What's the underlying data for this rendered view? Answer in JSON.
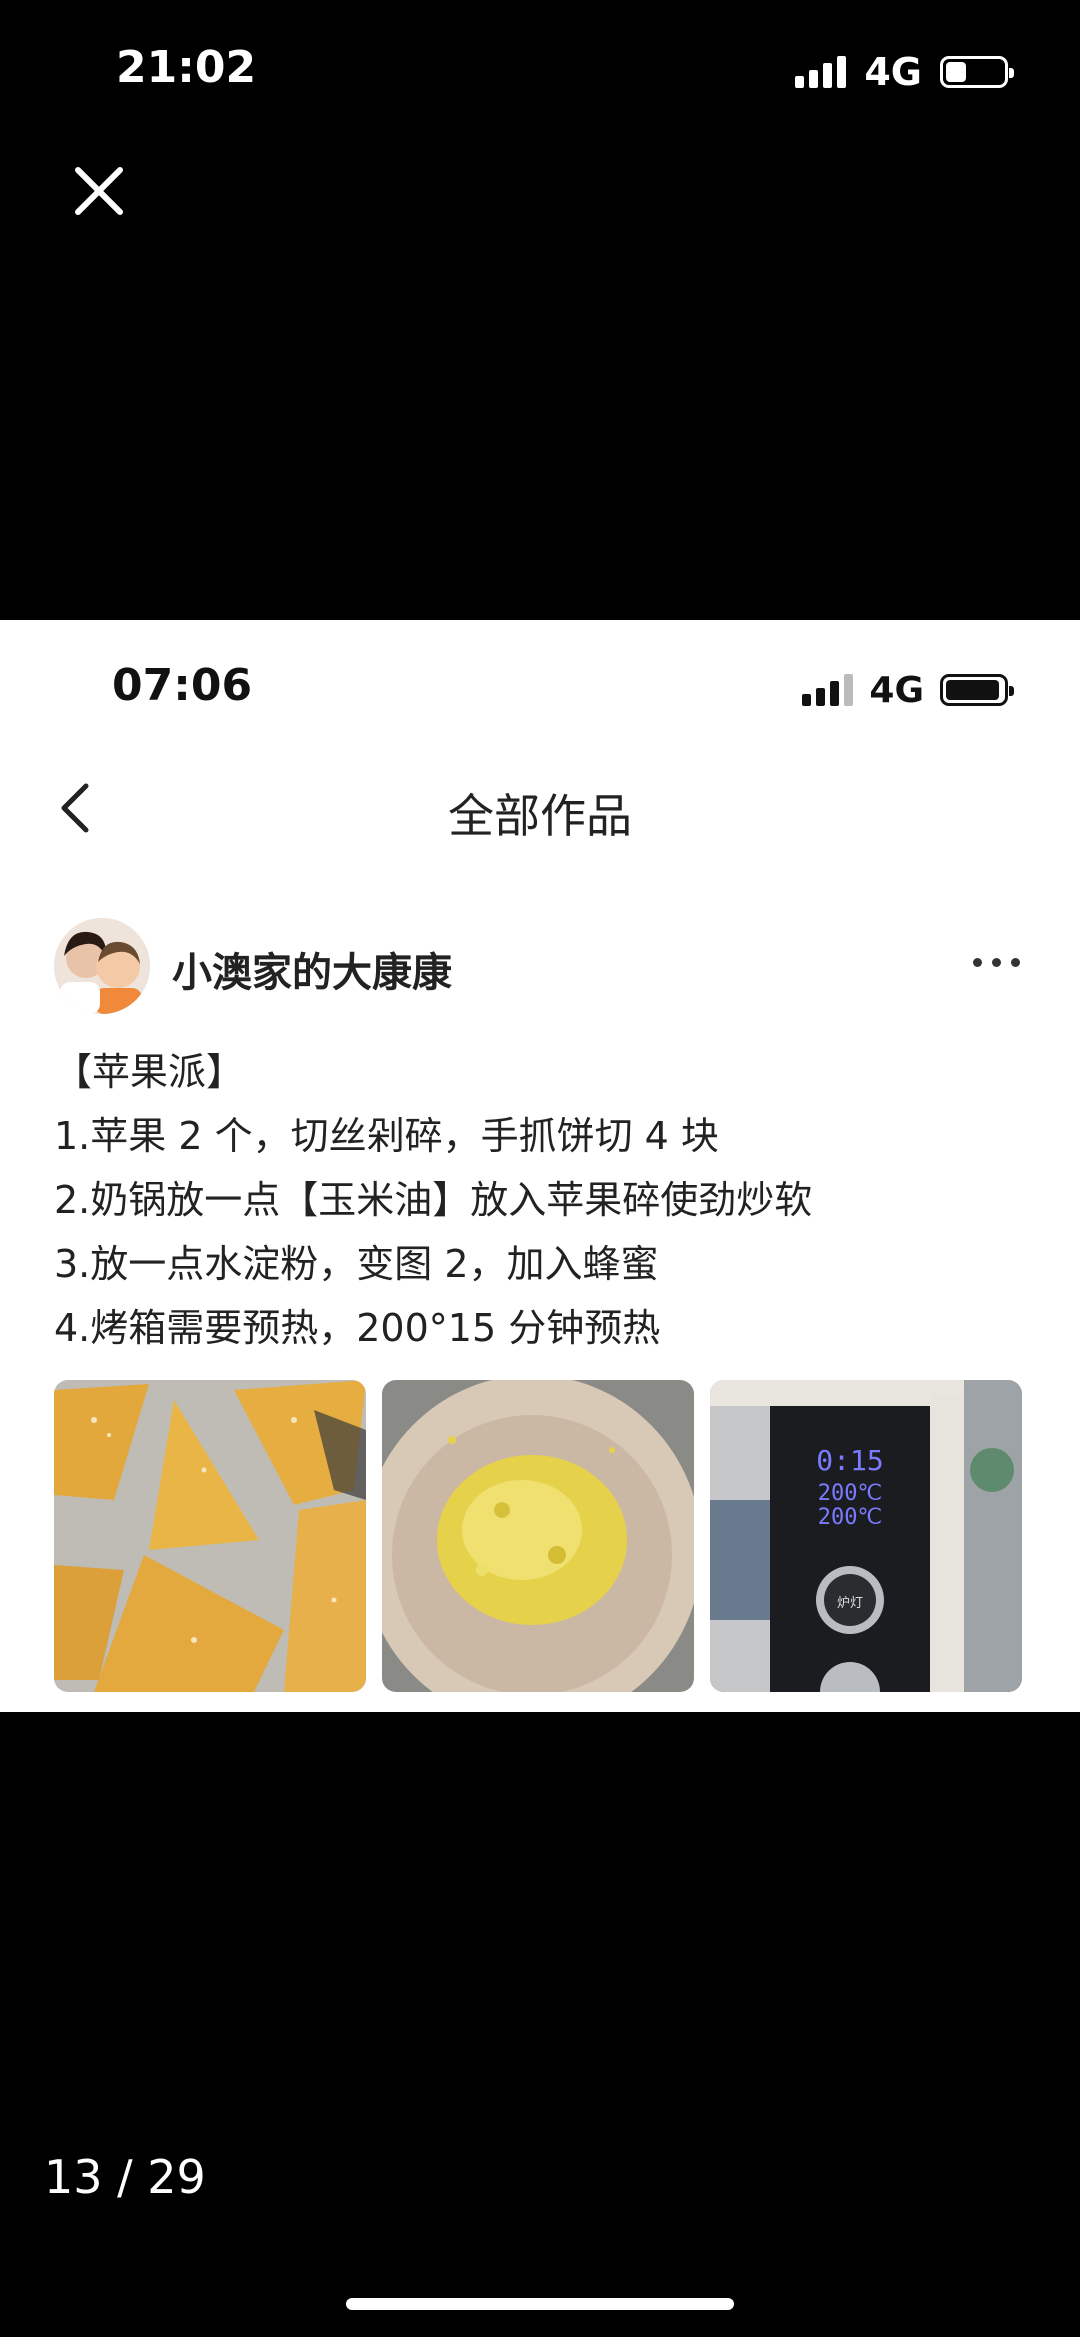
{
  "outer_status": {
    "time": "21:02",
    "network": "4G",
    "battery_fraction": 0.35
  },
  "viewer": {
    "close_icon": "close-icon",
    "page_counter": "13 / 29"
  },
  "screenshot": {
    "status": {
      "time": "07:06",
      "network": "4G",
      "battery_fraction": 0.95
    },
    "header": {
      "back_icon": "chevron-left-icon",
      "title": "全部作品"
    },
    "post": {
      "author": "小澳家的大康康",
      "more_icon": "more-icon",
      "lines": [
        "【苹果派】",
        "1.苹果 2 个，切丝剁碎，手抓饼切 4 块",
        "2.奶锅放一点【玉米油】放入苹果碎使劲炒软",
        "3.放一点水淀粉，变图 2，加入蜂蜜",
        "4.烤箱需要预热，200°15 分钟预热"
      ],
      "oven_display": {
        "time": "0:15",
        "top_temp": "200℃",
        "bottom_temp": "200℃",
        "knob_label": "炉灯"
      }
    }
  },
  "colors": {
    "background": "#000000",
    "card": "#ffffff",
    "text": "#222222",
    "oven_display": "#7b7bff"
  }
}
